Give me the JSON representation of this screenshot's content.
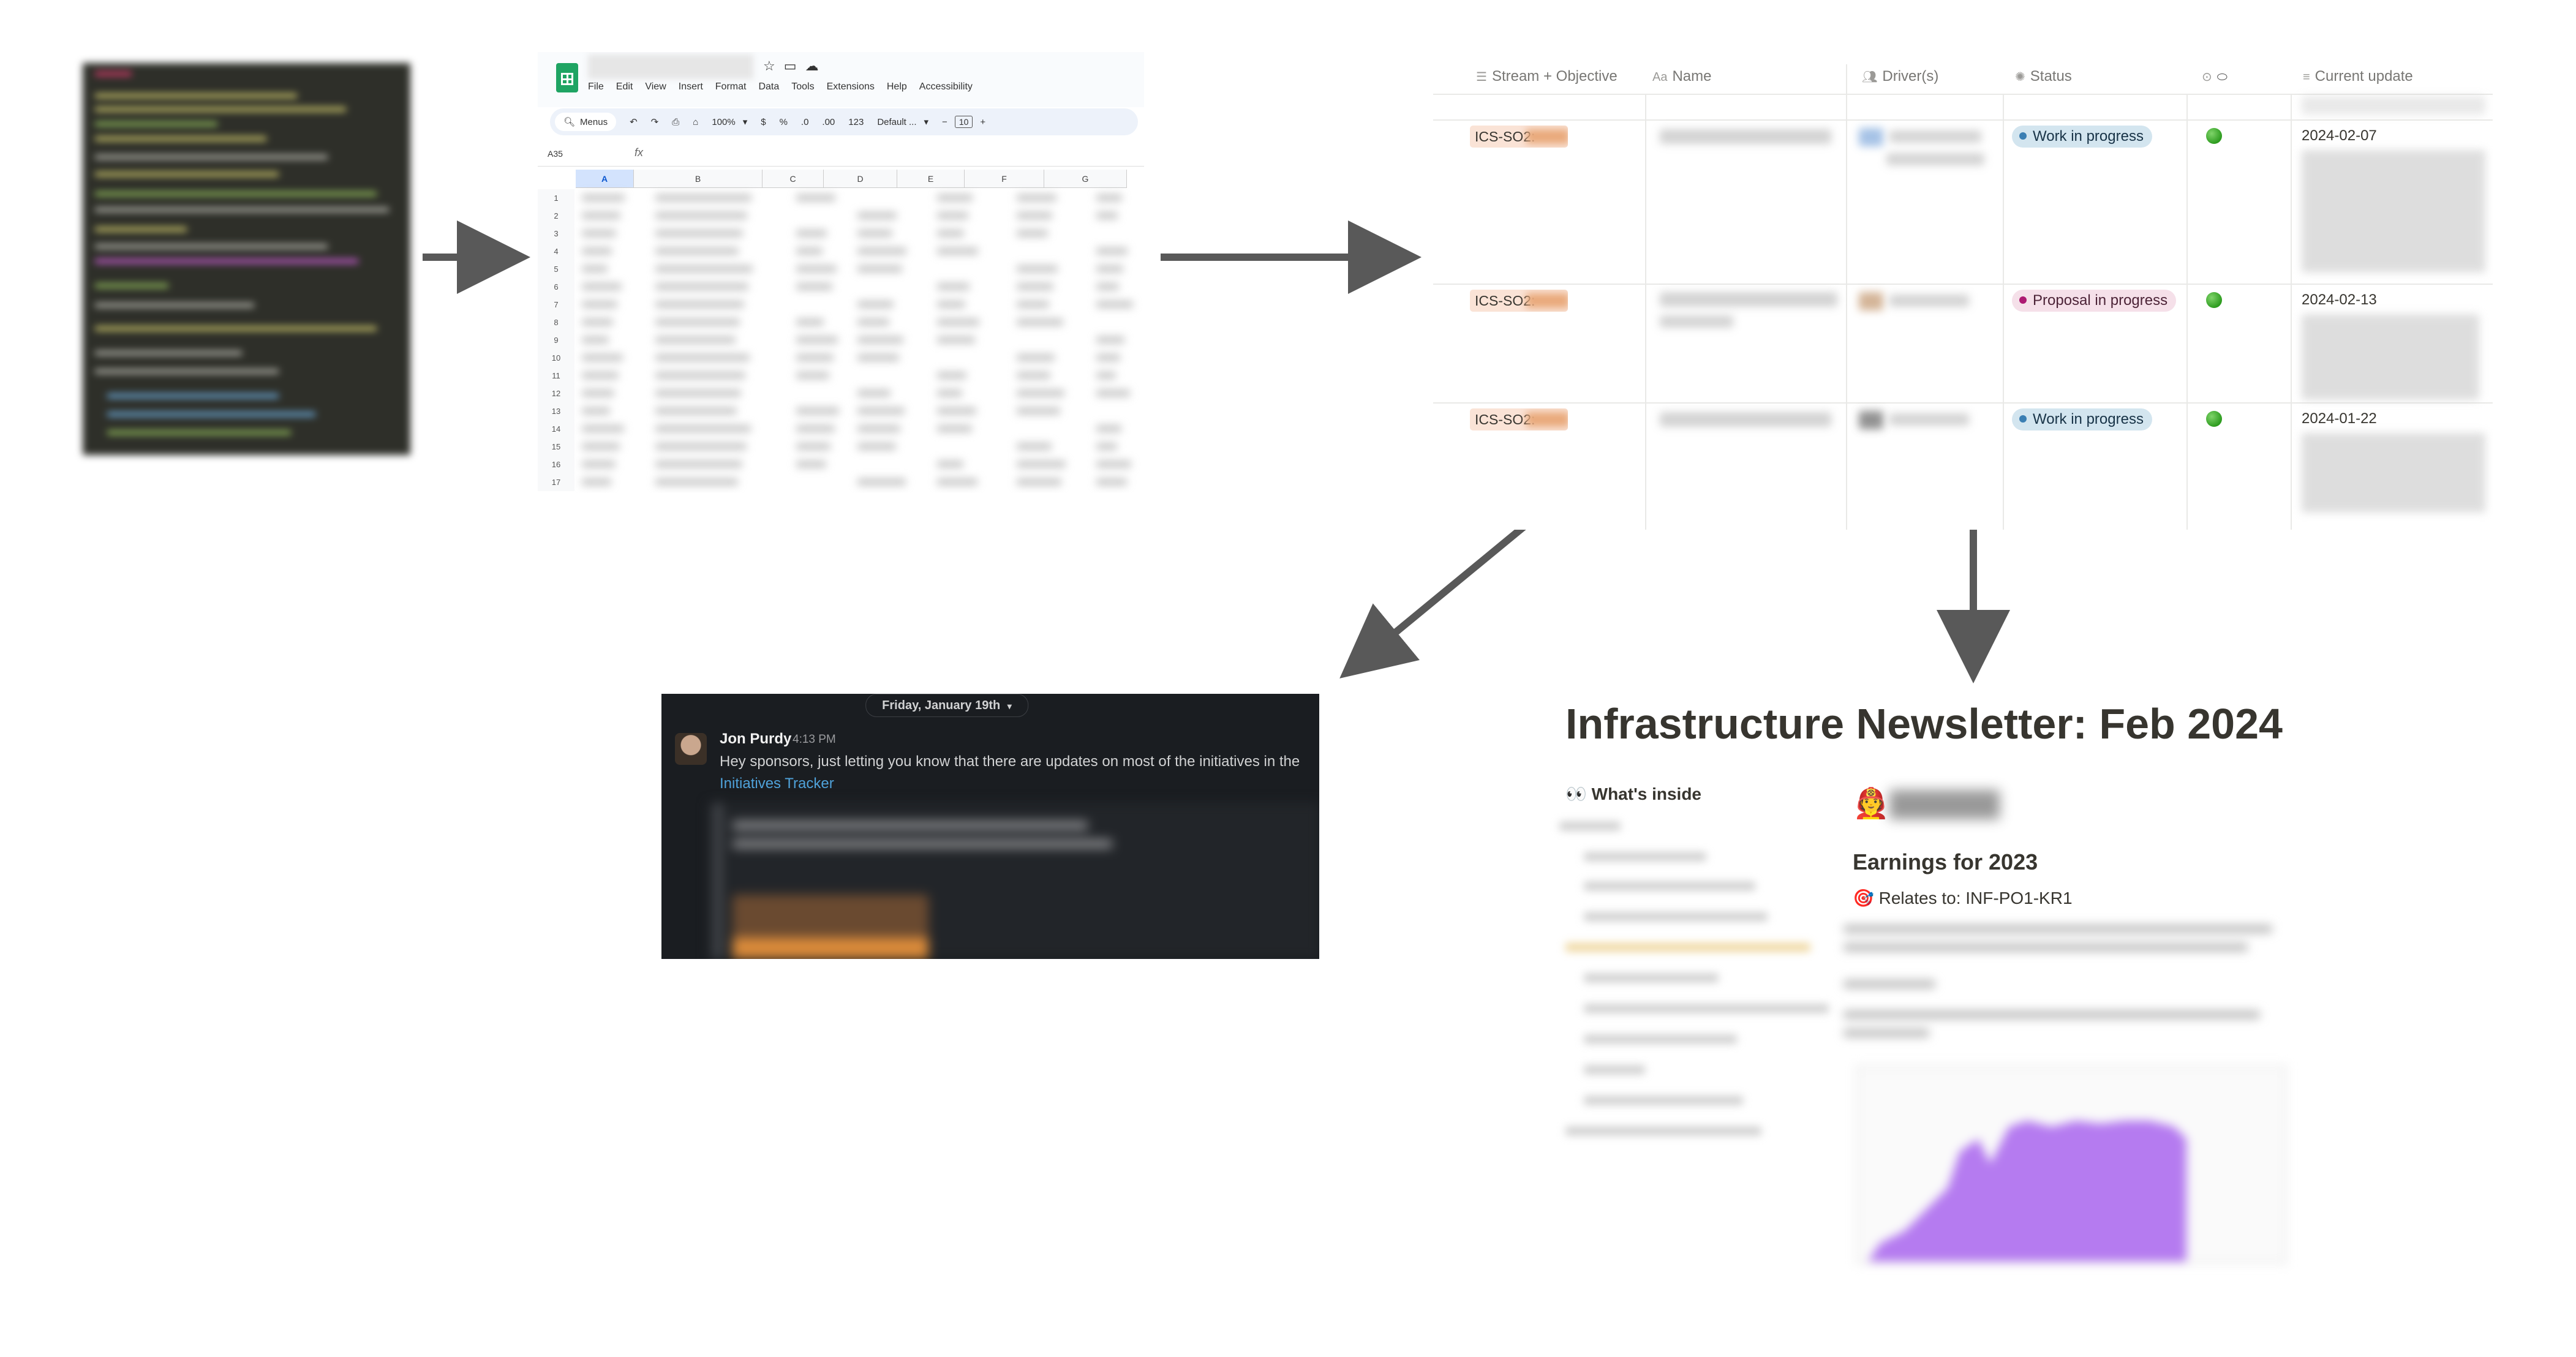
{
  "spreadsheet": {
    "menu": [
      "File",
      "Edit",
      "View",
      "Insert",
      "Format",
      "Data",
      "Tools",
      "Extensions",
      "Help",
      "Accessibility"
    ],
    "search_label": "Menus",
    "zoom": "100%",
    "currency": "$",
    "percent": "%",
    "dec_less": ".0",
    "dec_more": ".00",
    "number_format": "123",
    "font": "Default ...",
    "font_size": "10",
    "cell_ref": "A35",
    "fx": "fx",
    "columns": [
      "A",
      "B",
      "C",
      "D",
      "E",
      "F",
      "G"
    ],
    "rows": [
      "1",
      "2",
      "3",
      "4",
      "5",
      "6",
      "7",
      "8",
      "9",
      "10",
      "11",
      "12",
      "13",
      "14",
      "15",
      "16",
      "17"
    ]
  },
  "tracker": {
    "headers": {
      "stream": "Stream + Objective",
      "name": "Name",
      "drivers": "Driver(s)",
      "status": "Status",
      "update": "Current update"
    },
    "rows": [
      {
        "tag": "ICS-SO2:",
        "status": "Work in progress",
        "date": "2024-02-07"
      },
      {
        "tag": "ICS-SO2:",
        "status": "Proposal in progress",
        "date": "2024-02-13"
      },
      {
        "tag": "ICS-SO2:",
        "status": "Work in progress",
        "date": "2024-01-22"
      }
    ]
  },
  "slack": {
    "date_divider": "Friday, January 19th",
    "author": "Jon Purdy",
    "time": "4:13 PM",
    "message": "Hey sponsors, just letting you know that there are updates on most of the initiatives in the",
    "link": "Initiatives Tracker"
  },
  "newsletter": {
    "title": "Infrastructure Newsletter: Feb 2024",
    "whats_inside": "👀 What's inside",
    "hiring_emoji": "🧑‍🚒",
    "section_title": "Earnings for 2023",
    "relates_to": "🎯 Relates to: INF-PO1-KR1"
  },
  "colors": {
    "arrow": "#595959",
    "wip_badge": "#d3e5ef",
    "proposal_badge": "#f5e0e9",
    "tag_orange": "#fae3d6",
    "slack_bg": "#1a1d21",
    "slack_link": "#4fa2da",
    "chart_purple": "#b57bf0"
  }
}
